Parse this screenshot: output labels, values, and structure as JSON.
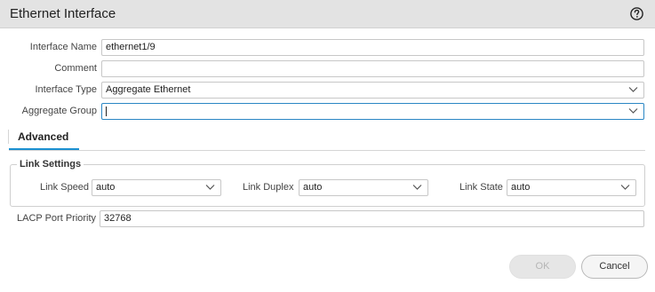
{
  "window": {
    "title": "Ethernet Interface",
    "help_icon": "question-circle-icon"
  },
  "form": {
    "interface_name": {
      "label": "Interface Name",
      "value": "ethernet1/9"
    },
    "comment": {
      "label": "Comment",
      "value": ""
    },
    "interface_type": {
      "label": "Interface Type",
      "value": "Aggregate Ethernet"
    },
    "aggregate_group": {
      "label": "Aggregate Group",
      "value": ""
    }
  },
  "tabs": [
    {
      "label": "Advanced",
      "active": true
    }
  ],
  "link_settings": {
    "legend": "Link Settings",
    "link_speed": {
      "label": "Link Speed",
      "value": "auto"
    },
    "link_duplex": {
      "label": "Link Duplex",
      "value": "auto"
    },
    "link_state": {
      "label": "Link State",
      "value": "auto"
    }
  },
  "lacp": {
    "label": "LACP Port Priority",
    "value": "32768"
  },
  "buttons": {
    "ok": "OK",
    "cancel": "Cancel"
  },
  "colors": {
    "accent": "#1b90d1",
    "focus_border": "#2a86c4",
    "titlebar": "#e3e3e3"
  }
}
